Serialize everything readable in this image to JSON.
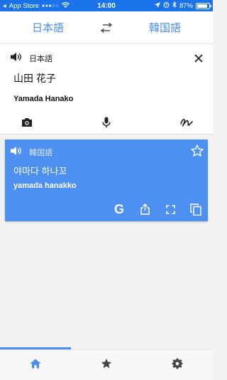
{
  "status_bar": {
    "carrier": "App Store",
    "signal_dots": "●●●○○",
    "time": "14:00",
    "battery_percent": "87%",
    "battery_level": 0.87
  },
  "lang_bar": {
    "source_language": "日本語",
    "target_language": "韓国語"
  },
  "input": {
    "language": "日本語",
    "text": "山田 花子",
    "transliteration": "Yamada Hanako"
  },
  "result": {
    "language": "韓国語",
    "text": "야마다 하나꼬",
    "transliteration": "yamada hanakko",
    "google_label": "G"
  },
  "colors": {
    "accent": "#4a8cf0",
    "result_bg": "#4e8ff2",
    "status_bg": "#1a73e8"
  },
  "bottom_nav": {
    "items": [
      "home-icon",
      "star-icon",
      "gear-icon"
    ],
    "active": "home-icon"
  }
}
